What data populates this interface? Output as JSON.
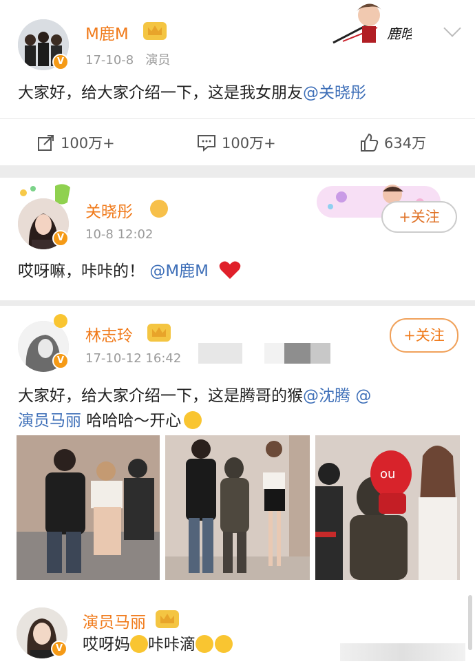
{
  "post1": {
    "author": "M鹿M",
    "meta": "17-10-8   演员",
    "content_text": "大家好，给大家介绍一下，这是我女朋友",
    "content_mention": "@关晓彤",
    "repost_count": "100万+",
    "comment_count": "100万+",
    "like_count": "634万",
    "banner_text": "鹿晗"
  },
  "post2": {
    "author": "关晓彤",
    "meta": "10-8 12:02",
    "content_text": "哎呀嘛，咔咔的！",
    "content_mention": "@M鹿M",
    "follow_label": "+关注"
  },
  "post3": {
    "author": "林志玲",
    "meta": "17-10-12 16:42",
    "content_line1": "大家好，给大家介绍一下，这是腾哥的猴",
    "mention1": "@沈腾",
    "mention2_a": "@",
    "mention2_b": "演员马丽",
    "content_tail": " 哈哈哈～开心",
    "follow_label": "+关注"
  },
  "comment": {
    "author": "演员马丽",
    "text_a": "哎呀妈",
    "text_b": "咔咔滴"
  },
  "colors": {
    "name_orange": "#f07a1a",
    "mention_blue": "#3e6fb8",
    "vip_orange": "#f59a16"
  }
}
